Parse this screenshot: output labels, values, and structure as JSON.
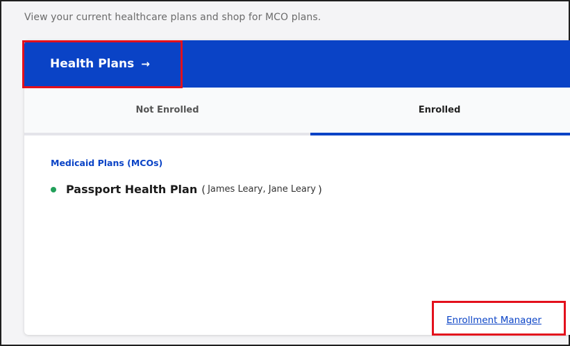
{
  "page": {
    "description": "View your current healthcare plans and shop for MCO plans."
  },
  "header": {
    "title": "Health Plans",
    "arrow": "→"
  },
  "tabs": [
    {
      "label": "Not Enrolled",
      "selected": false
    },
    {
      "label": "Enrolled",
      "selected": true
    }
  ],
  "section": {
    "title": "Medicaid Plans (MCOs)"
  },
  "plan": {
    "status_color": "#22a05a",
    "name": "Passport Health Plan",
    "open_paren": "(",
    "members": "James Leary, Jane Leary",
    "close_paren": ")"
  },
  "footer": {
    "link_label": "Enrollment Manager"
  },
  "colors": {
    "brand_blue": "#0a43c6",
    "highlight_red": "#e3101c"
  }
}
